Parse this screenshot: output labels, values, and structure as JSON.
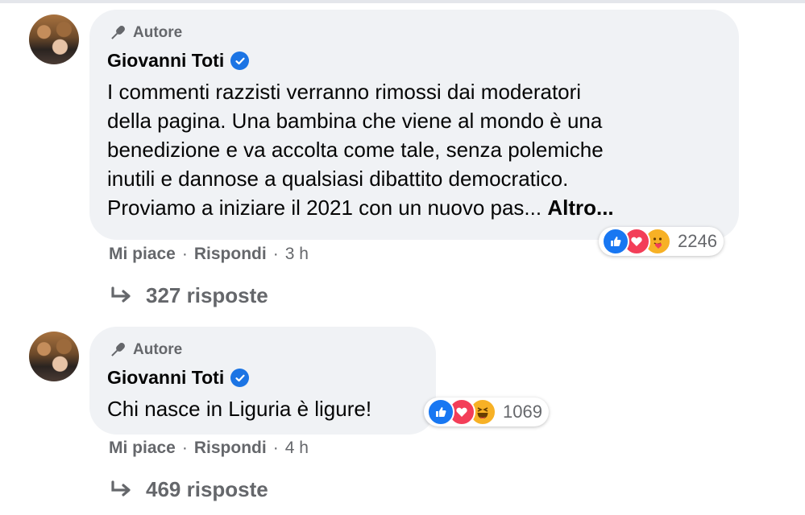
{
  "comments": [
    {
      "author_badge": "Autore",
      "author_name": "Giovanni Toti",
      "text_lines": [
        "I commenti razzisti verranno rimossi dai moderatori",
        "della pagina. Una bambina che viene al mondo è una",
        "benedizione e va accolta come tale, senza polemiche",
        "inutili e dannose a qualsiasi dibattito democratico.",
        "Proviamo a iniziare il 2021 con un nuovo pas... "
      ],
      "more_label": "Altro...",
      "reaction_icons": [
        "like-icon",
        "love-icon",
        "care-icon"
      ],
      "reaction_count": "2246",
      "like_label": "Mi piace",
      "reply_label": "Rispondi",
      "separator": "·",
      "time": "3 h",
      "replies_label": "327 risposte"
    },
    {
      "author_badge": "Autore",
      "author_name": "Giovanni Toti",
      "text_lines": [
        "Chi nasce in Liguria è ligure!"
      ],
      "reaction_icons": [
        "like-icon",
        "love-icon",
        "haha-icon"
      ],
      "reaction_count": "1069",
      "like_label": "Mi piace",
      "reply_label": "Rispondi",
      "separator": "·",
      "time": "4 h",
      "replies_label": "469 risposte"
    }
  ],
  "colors": {
    "bubble": "#f0f2f5",
    "secondary_text": "#65676b",
    "verified": "#1b74e4",
    "like": "#1877f2",
    "love": "#f33e58",
    "emoji": "#f7b125"
  }
}
